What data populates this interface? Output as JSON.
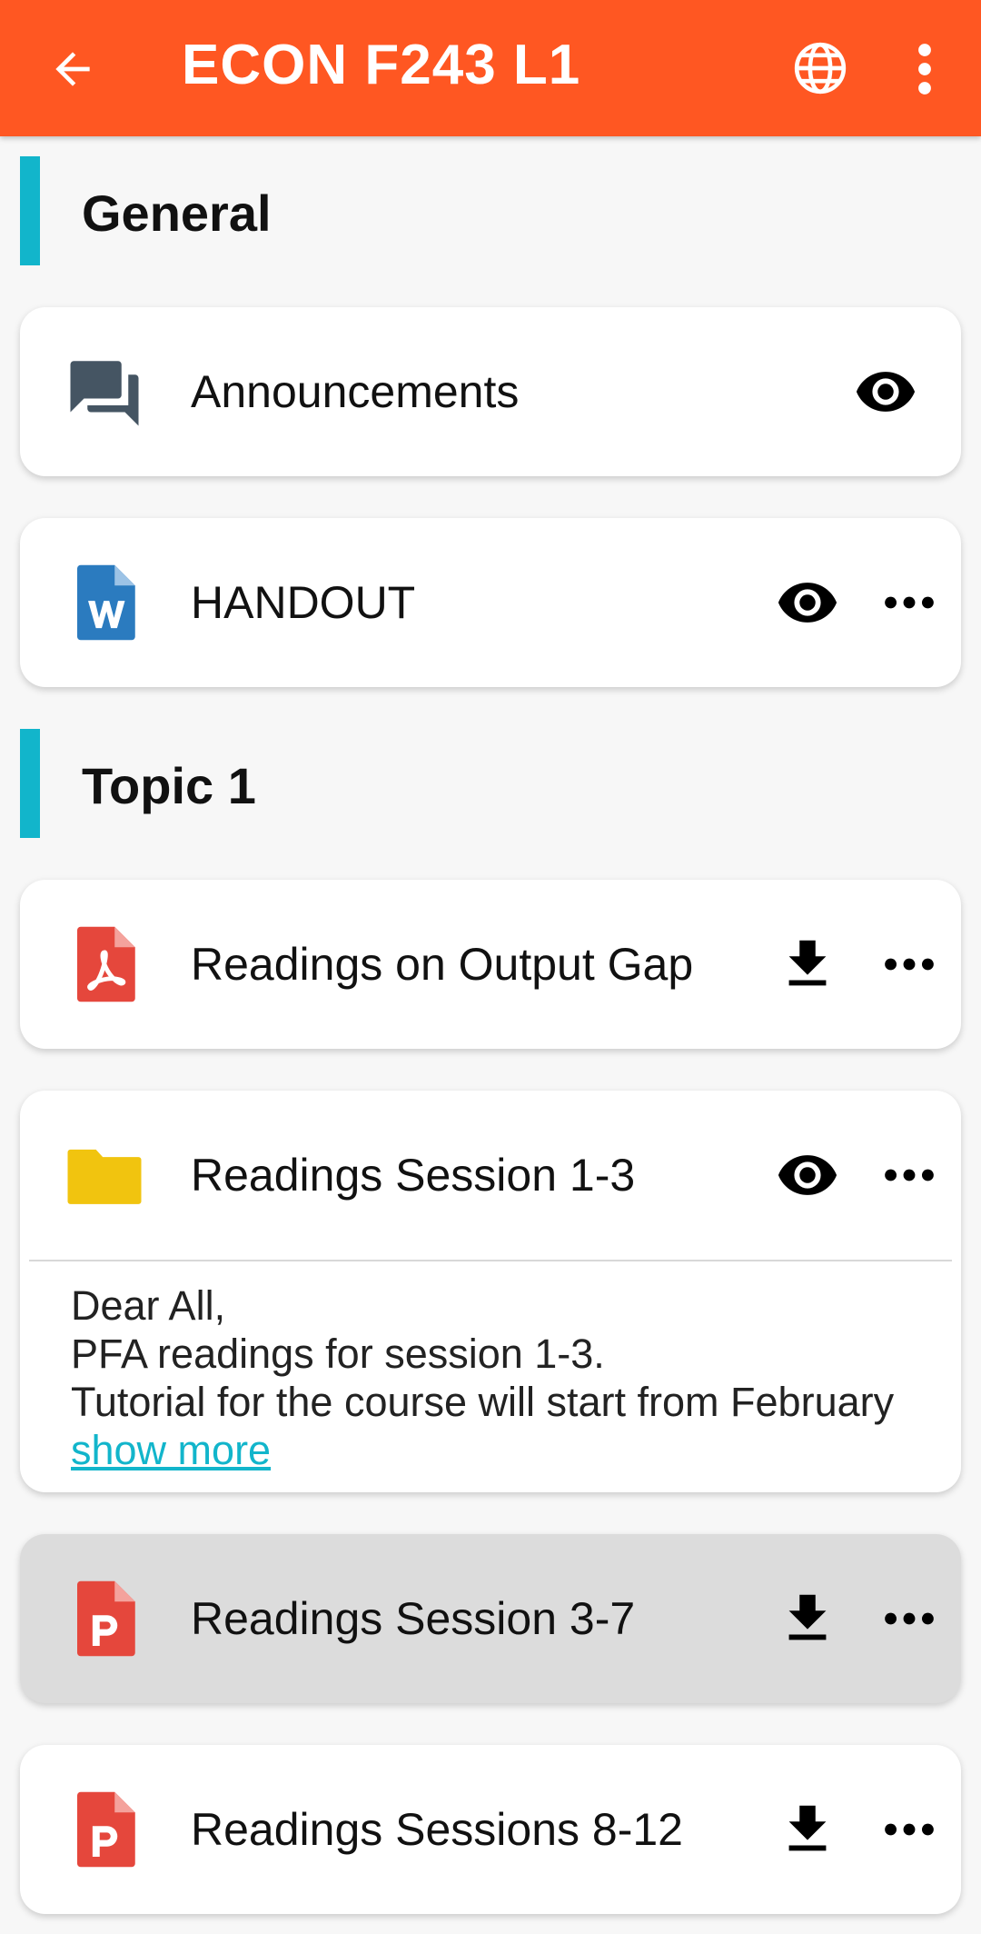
{
  "app_bar": {
    "title": "ECON F243 L1",
    "background_color": "#ff5722",
    "back_icon": "arrow-left-icon",
    "globe_icon": "globe-icon",
    "menu_icon": "more-vertical-icon"
  },
  "sections": [
    {
      "title": "General",
      "items": [
        {
          "name": "Announcements",
          "icon": "forum-icon",
          "actions": [
            "eye-icon"
          ]
        },
        {
          "name": "HANDOUT",
          "icon": "word-document-icon",
          "actions": [
            "eye-icon",
            "more-horizontal-icon"
          ]
        }
      ]
    },
    {
      "title": "Topic 1",
      "items": [
        {
          "name": "Readings on Output Gap",
          "icon": "pdf-icon",
          "actions": [
            "download-icon",
            "more-horizontal-icon"
          ]
        },
        {
          "name": "Readings Session 1-3",
          "icon": "folder-icon",
          "actions": [
            "eye-icon",
            "more-horizontal-icon"
          ],
          "description": {
            "lines": [
              "Dear All,",
              "PFA readings for session 1-3.",
              "Tutorial for the course will start from February"
            ],
            "show_more": "show more"
          }
        },
        {
          "name": "Readings Session 3-7",
          "icon": "powerpoint-icon",
          "actions": [
            "download-icon",
            "more-horizontal-icon"
          ],
          "state": "pressed"
        },
        {
          "name": "Readings Sessions 8-12",
          "icon": "powerpoint-icon",
          "actions": [
            "download-icon",
            "more-horizontal-icon"
          ]
        }
      ]
    }
  ],
  "colors": {
    "section_accent": "#12b5cb",
    "link": "#12b5cb",
    "pdf": "#e5473c",
    "word": "#2b7bbf",
    "folder": "#f1c40f",
    "forum": "#455563"
  }
}
